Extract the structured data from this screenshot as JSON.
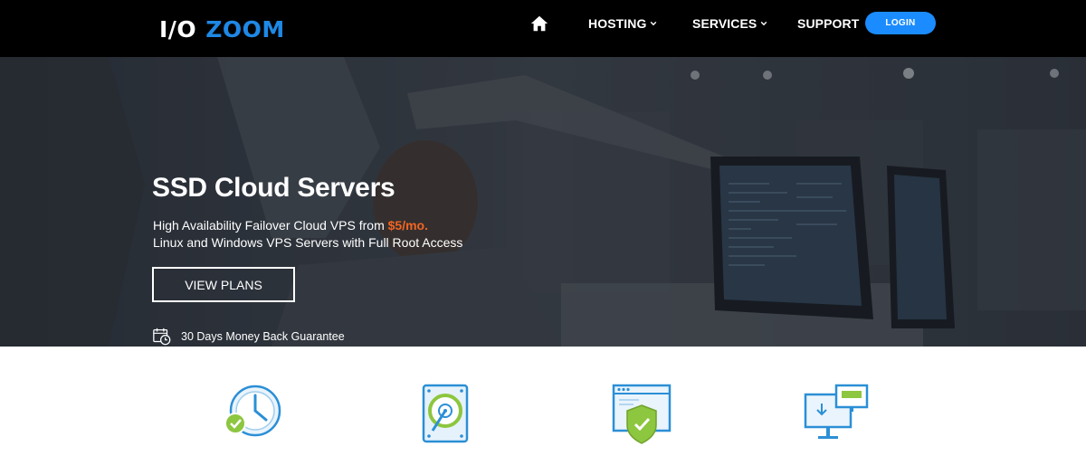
{
  "brand": {
    "logo_left": "I/O",
    "logo_right": "ZOOM"
  },
  "nav": {
    "home_icon": "home-icon",
    "items": [
      {
        "label": "HOSTING",
        "icon": "chevron-down-icon"
      },
      {
        "label": "SERVICES",
        "icon": "chevron-down-icon"
      },
      {
        "label": "SUPPORT"
      }
    ],
    "login_label": "LOGIN"
  },
  "hero": {
    "title": "SSD Cloud Servers",
    "line1_prefix": "High Availability Failover Cloud VPS from",
    "price": "$5/mo.",
    "line2": "Linux and Windows VPS Servers with Full Root Access",
    "cta_label": "VIEW PLANS",
    "guarantee_icon": "calendar-clock-icon",
    "guarantee_text": "30 Days Money Back Guarantee"
  },
  "features": {
    "icons": [
      "clock-check-icon",
      "hard-drive-icon",
      "browser-shield-icon",
      "monitor-transfer-icon"
    ]
  },
  "colors": {
    "accent_blue": "#1a8cff",
    "logo_blue": "#1e88e5",
    "price_orange": "#f26522",
    "icon_green": "#8dc63f",
    "navbar_bg": "#000000"
  }
}
